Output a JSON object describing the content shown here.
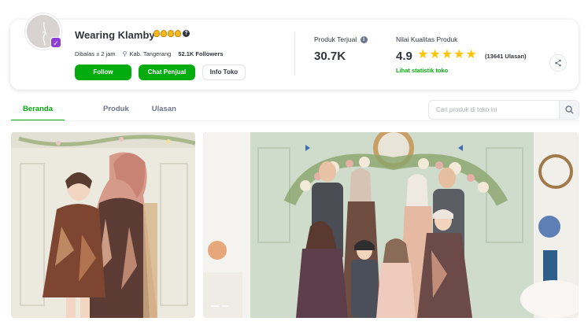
{
  "shop": {
    "name": "Wearing Klamby",
    "response_time": "Dibalas ± 2 jam",
    "location": "Kab. Tangerang",
    "followers": "52.1K Followers",
    "badge_icon": "official-store-badge",
    "medal_count": 4
  },
  "buttons": {
    "follow": "Follow",
    "chat": "Chat Penjual",
    "info": "Info Toko"
  },
  "stats": {
    "sold_label": "Produk Terjual",
    "sold_value": "30.7K",
    "quality_label": "Nilai Kualitas Produk",
    "rating": "4.9",
    "rating_stars": 5,
    "reviews": "(13641 Ulasan)",
    "stats_link": "Lihat statistik toko"
  },
  "tabs": [
    {
      "label": "Beranda",
      "active": true
    },
    {
      "label": "Produk",
      "active": false
    },
    {
      "label": "Ulasan",
      "active": false
    }
  ],
  "search": {
    "placeholder": "Cari produk di toko ini"
  },
  "colors": {
    "brand_green": "#03ac0e",
    "star_yellow": "#ffc400",
    "text_dark": "#31353b",
    "text_muted": "#6d7588"
  },
  "carousel": {
    "slides": 2,
    "active_slide": 1
  }
}
